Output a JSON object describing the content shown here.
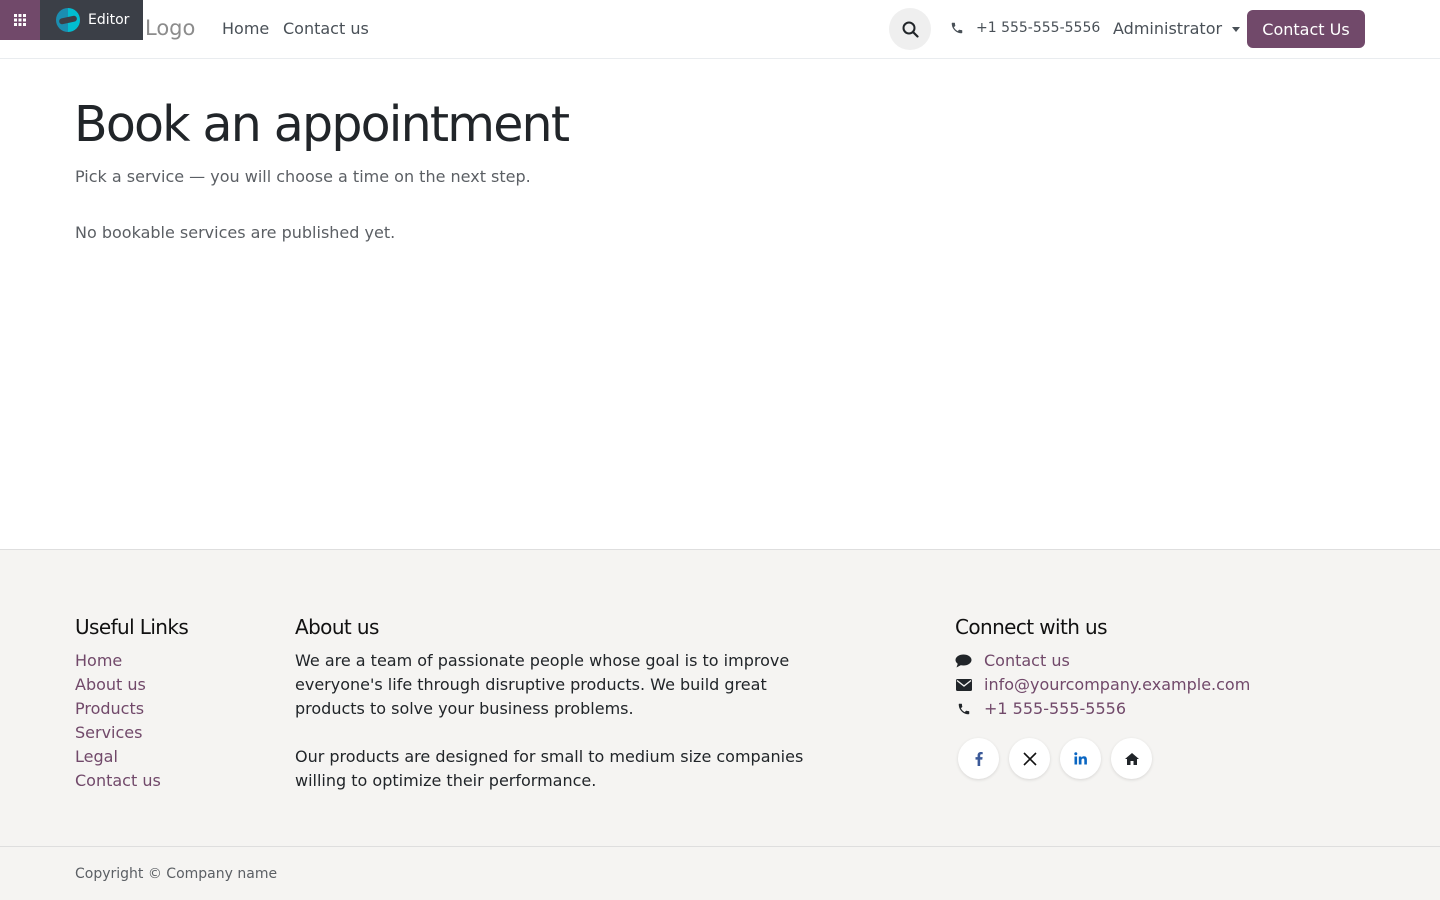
{
  "editor": {
    "label": "Editor"
  },
  "header": {
    "logo": "Logo",
    "nav": [
      {
        "label": "Home"
      },
      {
        "label": "Contact us"
      }
    ],
    "phone": "+1 555-555-5556",
    "user": "Administrator",
    "cta": "Contact Us"
  },
  "main": {
    "title": "Book an appointment",
    "subtitle": "Pick a service — you will choose a time on the next step.",
    "empty_message": "No bookable services are published yet."
  },
  "footer": {
    "links_title": "Useful Links",
    "links": [
      "Home",
      "About us",
      "Products",
      "Services",
      "Legal",
      "Contact us"
    ],
    "about_title": "About us",
    "about_p1": "We are a team of passionate people whose goal is to improve everyone's life through disruptive products. We build great products to solve your business problems.",
    "about_p2": "Our products are designed for small to medium size companies willing to optimize their performance.",
    "connect_title": "Connect with us",
    "connect": [
      {
        "icon": "comment-icon",
        "label": "Contact us"
      },
      {
        "icon": "envelope-icon",
        "label": "info@yourcompany.example.com"
      },
      {
        "icon": "phone-icon",
        "label": "+1 555-555-5556"
      }
    ],
    "socials": [
      "facebook-icon",
      "x-twitter-icon",
      "linkedin-icon",
      "home-icon"
    ],
    "copyright": "Copyright © Company name"
  },
  "colors": {
    "brand": "#71496a",
    "editor_bar": "#3b3f47",
    "footer_bg": "#f5f4f2"
  }
}
